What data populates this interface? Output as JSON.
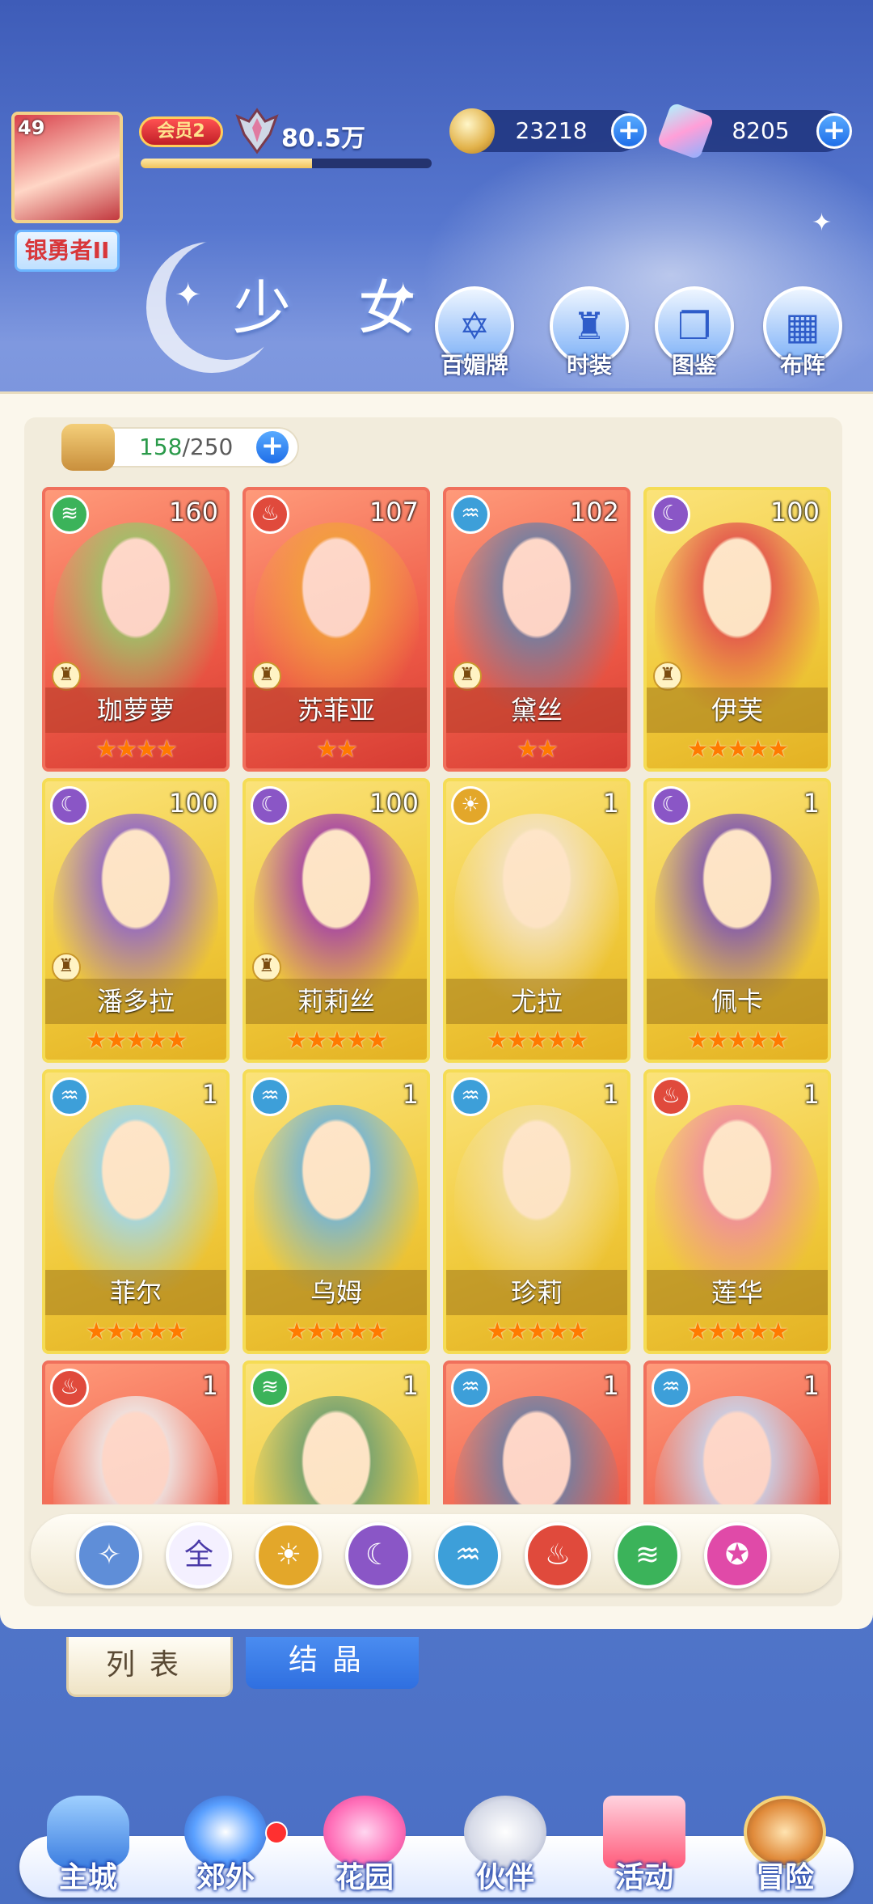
{
  "player": {
    "level": "49",
    "rank_title": "银勇者II",
    "vip_label": "会员2",
    "power": "80.5万",
    "exp_fraction": 0.59
  },
  "resources": {
    "coins": "23218",
    "gems": "8205"
  },
  "page_title": "少 女",
  "functions": [
    {
      "label": "百媚牌",
      "icon": "card-icon"
    },
    {
      "label": "时装",
      "icon": "outfit-icon"
    },
    {
      "label": "图鉴",
      "icon": "book-icon"
    },
    {
      "label": "布阵",
      "icon": "formation-icon"
    }
  ],
  "bag": {
    "current": "158",
    "max": "/250"
  },
  "cards": [
    {
      "name": "珈萝萝",
      "level": "160",
      "element": "wind",
      "stars": 4,
      "frame": "red",
      "art": "#9bc36a"
    },
    {
      "name": "苏菲亚",
      "level": "107",
      "element": "fire",
      "stars": 2,
      "frame": "red",
      "art": "#f2a03c"
    },
    {
      "name": "黛丝",
      "level": "102",
      "element": "water",
      "stars": 2,
      "frame": "red",
      "art": "#6c7fa5"
    },
    {
      "name": "伊芙",
      "level": "100",
      "element": "moon",
      "stars": 5,
      "frame": "gold",
      "art": "#e2504c"
    },
    {
      "name": "潘多拉",
      "level": "100",
      "element": "moon",
      "stars": 5,
      "frame": "gold",
      "art": "#8e63c9"
    },
    {
      "name": "莉莉丝",
      "level": "100",
      "element": "moon",
      "stars": 5,
      "frame": "gold",
      "art": "#a23ea8"
    },
    {
      "name": "尤拉",
      "level": "1",
      "element": "sun",
      "stars": 5,
      "frame": "gold",
      "art": "#f4e2c4"
    },
    {
      "name": "佩卡",
      "level": "1",
      "element": "moon",
      "stars": 5,
      "frame": "gold",
      "art": "#7d54b2"
    },
    {
      "name": "菲尔",
      "level": "1",
      "element": "water",
      "stars": 5,
      "frame": "gold",
      "art": "#9dd6ef"
    },
    {
      "name": "乌姆",
      "level": "1",
      "element": "water",
      "stars": 5,
      "frame": "gold",
      "art": "#6fb3db"
    },
    {
      "name": "珍莉",
      "level": "1",
      "element": "water",
      "stars": 5,
      "frame": "gold",
      "art": "#f2dea0"
    },
    {
      "name": "莲华",
      "level": "1",
      "element": "fire",
      "stars": 5,
      "frame": "gold",
      "art": "#ef8aa0"
    },
    {
      "name": "",
      "level": "1",
      "element": "fire",
      "stars": 0,
      "frame": "red",
      "art": "#eeeeee"
    },
    {
      "name": "",
      "level": "1",
      "element": "wind",
      "stars": 0,
      "frame": "gold",
      "art": "#6e9f72"
    },
    {
      "name": "",
      "level": "1",
      "element": "water",
      "stars": 0,
      "frame": "red",
      "art": "#6c7fa5"
    },
    {
      "name": "",
      "level": "1",
      "element": "water",
      "stars": 0,
      "frame": "red",
      "art": "#c7d6ef"
    }
  ],
  "filters": [
    {
      "label": "",
      "icon": "all-type-icon",
      "color": "#5f8ed8"
    },
    {
      "label": "全",
      "icon": "all-icon",
      "color": "#f4f0ff"
    },
    {
      "label": "",
      "icon": "sun-icon",
      "color": "#e3a72a"
    },
    {
      "label": "",
      "icon": "moon-icon",
      "color": "#8a56c6"
    },
    {
      "label": "",
      "icon": "water-icon",
      "color": "#3d9fd9"
    },
    {
      "label": "",
      "icon": "fire-icon",
      "color": "#e04a3c"
    },
    {
      "label": "",
      "icon": "wind-icon",
      "color": "#3bb35a"
    },
    {
      "label": "",
      "icon": "star-element-icon",
      "color": "#e04aa8"
    }
  ],
  "tabs": [
    {
      "label": "列表",
      "active": true
    },
    {
      "label": "结晶",
      "active": false
    }
  ],
  "nav": [
    {
      "label": "主城",
      "icon": "castle-icon"
    },
    {
      "label": "郊外",
      "icon": "portal-icon"
    },
    {
      "label": "花园",
      "icon": "heart-icon"
    },
    {
      "label": "伙伴",
      "icon": "partner-icon"
    },
    {
      "label": "活动",
      "icon": "gift-icon"
    },
    {
      "label": "冒险",
      "icon": "compass-icon"
    }
  ],
  "colors": {
    "accent": "#1f6ee8",
    "panel": "#fbf7ec",
    "gold_frame": "#f0c93a",
    "red_frame": "#ee5a47"
  }
}
